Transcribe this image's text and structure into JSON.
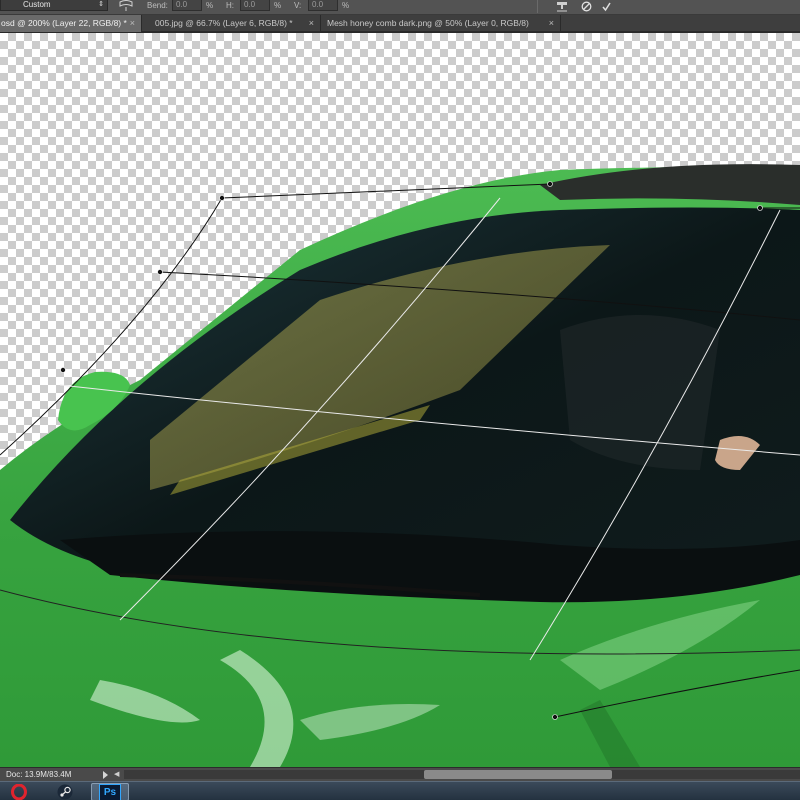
{
  "options_bar": {
    "warp_preset": "Custom",
    "bend_label": "Bend:",
    "bend_value": "0.0",
    "h_label": "H:",
    "h_value": "0.0",
    "v_label": "V:",
    "v_value": "0.0",
    "percent": "%"
  },
  "tabs": [
    {
      "label": "osd @ 200% (Layer 22, RGB/8) *",
      "close": "×"
    },
    {
      "label": "005.jpg @ 66.7% (Layer 6, RGB/8) *",
      "close": "×"
    },
    {
      "label": "Mesh honey comb dark.png @ 50% (Layer 0, RGB/8)",
      "close": "×"
    }
  ],
  "status_bar": {
    "doc_info": "Doc: 13.9M/83.4M",
    "scroll_left_arrow": "◀"
  },
  "taskbar": {
    "apps": [
      {
        "name": "opera",
        "icon": "opera-icon"
      },
      {
        "name": "steam",
        "icon": "steam-icon"
      },
      {
        "name": "photoshop",
        "icon": "photoshop-icon",
        "label": "Ps"
      }
    ]
  },
  "colors": {
    "car_green": "#3fae47",
    "glass_dark": "#0d1a1c",
    "ps_blue": "#32a7ff",
    "ui_gray": "#535353"
  }
}
